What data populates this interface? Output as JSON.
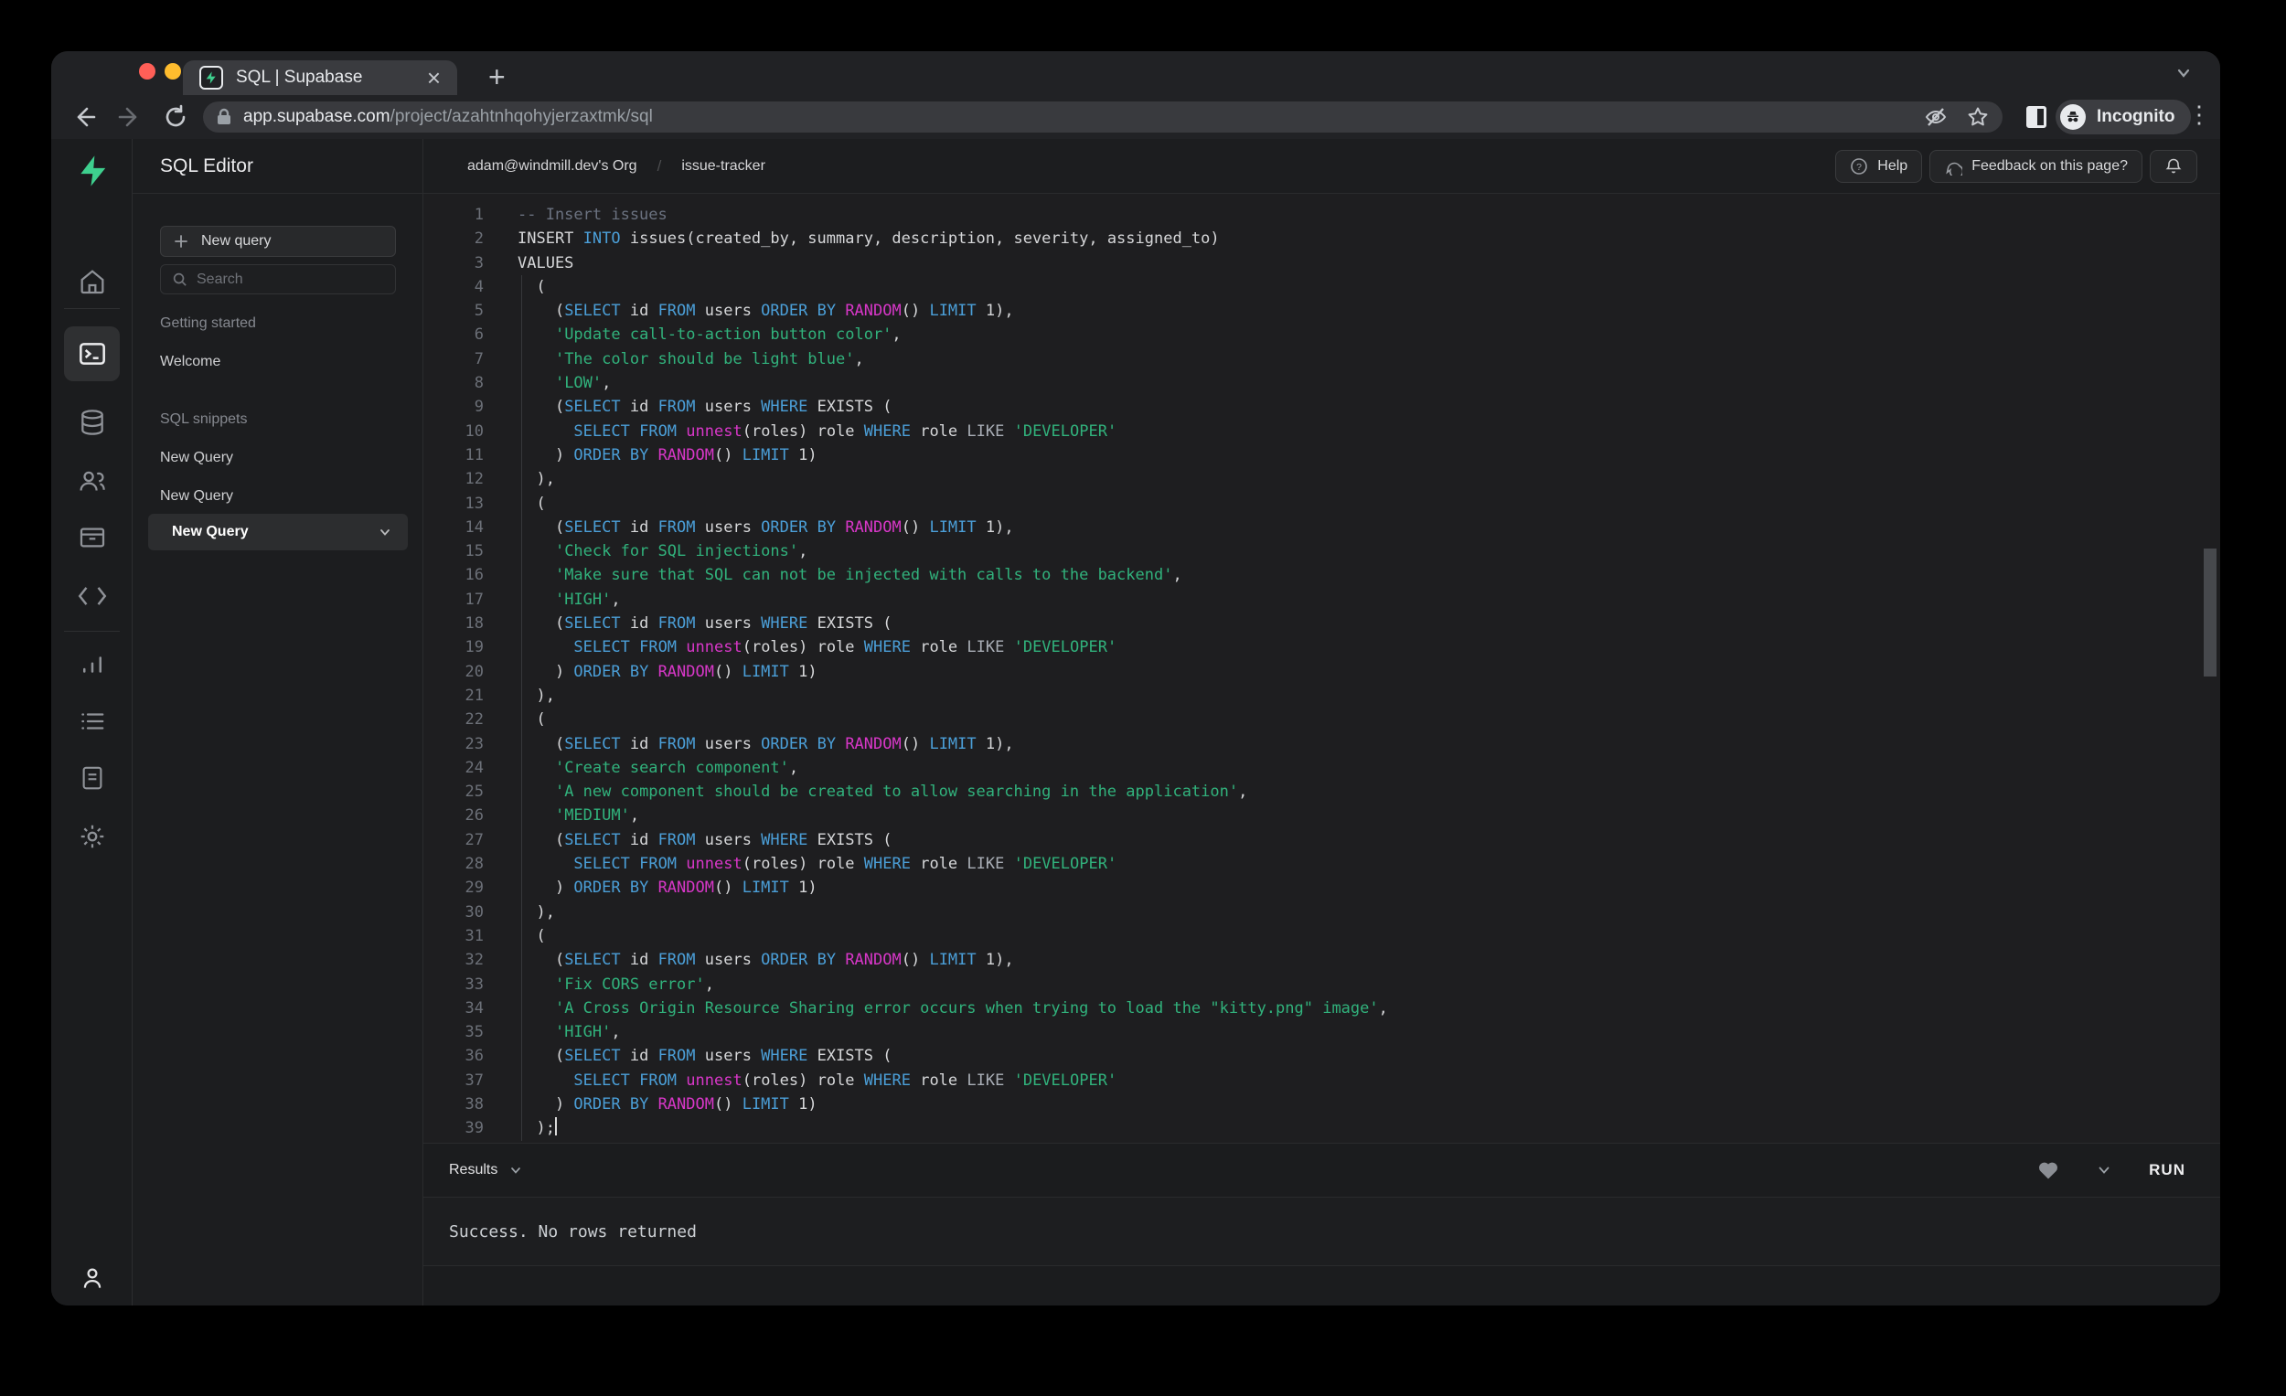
{
  "window": {
    "tab_title": "SQL | Supabase",
    "close_glyph": "×",
    "newtab_glyph": "+",
    "kebab_glyph": "⋮",
    "url_host": "app.supabase.com",
    "url_path": "/project/azahtnhqohyjerzaxtmk/sql",
    "incognito_label": "Incognito"
  },
  "colors": {
    "accent_green": "#3ecf8e",
    "keyword_blue": "#4b9fd8",
    "function_magenta": "#d837c8",
    "string_green": "#31b27c",
    "comment_gray": "#6b7280"
  },
  "sidebar": {
    "title": "SQL Editor",
    "new_query_button": "New query",
    "search_placeholder": "Search",
    "getting_started_label": "Getting started",
    "welcome_label": "Welcome",
    "snippets_label": "SQL snippets",
    "snippet_items": [
      "New Query",
      "New Query"
    ],
    "selected_snippet": "New Query"
  },
  "topbar": {
    "org": "adam@windmill.dev's Org",
    "separator": "/",
    "project": "issue-tracker",
    "help_label": "Help",
    "help_glyph": "?",
    "feedback_label": "Feedback on this page?"
  },
  "results": {
    "label": "Results",
    "run_label": "RUN",
    "message": "Success. No rows returned"
  },
  "editor": {
    "lines": [
      {
        "n": 1,
        "t": [
          [
            "com",
            "-- Insert issues"
          ]
        ]
      },
      {
        "n": 2,
        "t": [
          [
            "pl",
            "INSERT "
          ],
          [
            "kw",
            "INTO"
          ],
          [
            "pl",
            " issues(created_by, summary, description, severity, assigned_to)"
          ]
        ]
      },
      {
        "n": 3,
        "t": [
          [
            "pl",
            "VALUES"
          ]
        ]
      },
      {
        "n": 4,
        "t": [
          [
            "pl",
            "  ("
          ]
        ]
      },
      {
        "n": 5,
        "t": [
          [
            "pl",
            "    ("
          ],
          [
            "kw",
            "SELECT"
          ],
          [
            "pl",
            " id "
          ],
          [
            "kw",
            "FROM"
          ],
          [
            "pl",
            " users "
          ],
          [
            "kw",
            "ORDER BY"
          ],
          [
            "pl",
            " "
          ],
          [
            "fn",
            "RANDOM"
          ],
          [
            "pl",
            "() "
          ],
          [
            "kw",
            "LIMIT"
          ],
          [
            "pl",
            " 1),"
          ]
        ]
      },
      {
        "n": 6,
        "t": [
          [
            "pl",
            "    "
          ],
          [
            "str",
            "'Update call-to-action button color'"
          ],
          [
            "pl",
            ","
          ]
        ]
      },
      {
        "n": 7,
        "t": [
          [
            "pl",
            "    "
          ],
          [
            "str",
            "'The color should be light blue'"
          ],
          [
            "pl",
            ","
          ]
        ]
      },
      {
        "n": 8,
        "t": [
          [
            "pl",
            "    "
          ],
          [
            "str",
            "'LOW'"
          ],
          [
            "pl",
            ","
          ]
        ]
      },
      {
        "n": 9,
        "t": [
          [
            "pl",
            "    ("
          ],
          [
            "kw",
            "SELECT"
          ],
          [
            "pl",
            " id "
          ],
          [
            "kw",
            "FROM"
          ],
          [
            "pl",
            " users "
          ],
          [
            "kw",
            "WHERE"
          ],
          [
            "pl",
            " EXISTS ("
          ]
        ]
      },
      {
        "n": 10,
        "t": [
          [
            "pl",
            "      "
          ],
          [
            "kw",
            "SELECT"
          ],
          [
            "pl",
            " "
          ],
          [
            "kw",
            "FROM"
          ],
          [
            "pl",
            " "
          ],
          [
            "fn",
            "unnest"
          ],
          [
            "pl",
            "(roles) role "
          ],
          [
            "kw",
            "WHERE"
          ],
          [
            "pl",
            " role "
          ],
          [
            "lk",
            "LIKE"
          ],
          [
            "pl",
            " "
          ],
          [
            "str",
            "'DEVELOPER'"
          ]
        ]
      },
      {
        "n": 11,
        "t": [
          [
            "pl",
            "    ) "
          ],
          [
            "kw",
            "ORDER BY"
          ],
          [
            "pl",
            " "
          ],
          [
            "fn",
            "RANDOM"
          ],
          [
            "pl",
            "() "
          ],
          [
            "kw",
            "LIMIT"
          ],
          [
            "pl",
            " 1)"
          ]
        ]
      },
      {
        "n": 12,
        "t": [
          [
            "pl",
            "  ),"
          ]
        ]
      },
      {
        "n": 13,
        "t": [
          [
            "pl",
            "  ("
          ]
        ]
      },
      {
        "n": 14,
        "t": [
          [
            "pl",
            "    ("
          ],
          [
            "kw",
            "SELECT"
          ],
          [
            "pl",
            " id "
          ],
          [
            "kw",
            "FROM"
          ],
          [
            "pl",
            " users "
          ],
          [
            "kw",
            "ORDER BY"
          ],
          [
            "pl",
            " "
          ],
          [
            "fn",
            "RANDOM"
          ],
          [
            "pl",
            "() "
          ],
          [
            "kw",
            "LIMIT"
          ],
          [
            "pl",
            " 1),"
          ]
        ]
      },
      {
        "n": 15,
        "t": [
          [
            "pl",
            "    "
          ],
          [
            "str",
            "'Check for SQL injections'"
          ],
          [
            "pl",
            ","
          ]
        ]
      },
      {
        "n": 16,
        "t": [
          [
            "pl",
            "    "
          ],
          [
            "str",
            "'Make sure that SQL can not be injected with calls to the backend'"
          ],
          [
            "pl",
            ","
          ]
        ]
      },
      {
        "n": 17,
        "t": [
          [
            "pl",
            "    "
          ],
          [
            "str",
            "'HIGH'"
          ],
          [
            "pl",
            ","
          ]
        ]
      },
      {
        "n": 18,
        "t": [
          [
            "pl",
            "    ("
          ],
          [
            "kw",
            "SELECT"
          ],
          [
            "pl",
            " id "
          ],
          [
            "kw",
            "FROM"
          ],
          [
            "pl",
            " users "
          ],
          [
            "kw",
            "WHERE"
          ],
          [
            "pl",
            " EXISTS ("
          ]
        ]
      },
      {
        "n": 19,
        "t": [
          [
            "pl",
            "      "
          ],
          [
            "kw",
            "SELECT"
          ],
          [
            "pl",
            " "
          ],
          [
            "kw",
            "FROM"
          ],
          [
            "pl",
            " "
          ],
          [
            "fn",
            "unnest"
          ],
          [
            "pl",
            "(roles) role "
          ],
          [
            "kw",
            "WHERE"
          ],
          [
            "pl",
            " role "
          ],
          [
            "lk",
            "LIKE"
          ],
          [
            "pl",
            " "
          ],
          [
            "str",
            "'DEVELOPER'"
          ]
        ]
      },
      {
        "n": 20,
        "t": [
          [
            "pl",
            "    ) "
          ],
          [
            "kw",
            "ORDER BY"
          ],
          [
            "pl",
            " "
          ],
          [
            "fn",
            "RANDOM"
          ],
          [
            "pl",
            "() "
          ],
          [
            "kw",
            "LIMIT"
          ],
          [
            "pl",
            " 1)"
          ]
        ]
      },
      {
        "n": 21,
        "t": [
          [
            "pl",
            "  ),"
          ]
        ]
      },
      {
        "n": 22,
        "t": [
          [
            "pl",
            "  ("
          ]
        ]
      },
      {
        "n": 23,
        "t": [
          [
            "pl",
            "    ("
          ],
          [
            "kw",
            "SELECT"
          ],
          [
            "pl",
            " id "
          ],
          [
            "kw",
            "FROM"
          ],
          [
            "pl",
            " users "
          ],
          [
            "kw",
            "ORDER BY"
          ],
          [
            "pl",
            " "
          ],
          [
            "fn",
            "RANDOM"
          ],
          [
            "pl",
            "() "
          ],
          [
            "kw",
            "LIMIT"
          ],
          [
            "pl",
            " 1),"
          ]
        ]
      },
      {
        "n": 24,
        "t": [
          [
            "pl",
            "    "
          ],
          [
            "str",
            "'Create search component'"
          ],
          [
            "pl",
            ","
          ]
        ]
      },
      {
        "n": 25,
        "t": [
          [
            "pl",
            "    "
          ],
          [
            "str",
            "'A new component should be created to allow searching in the application'"
          ],
          [
            "pl",
            ","
          ]
        ]
      },
      {
        "n": 26,
        "t": [
          [
            "pl",
            "    "
          ],
          [
            "str",
            "'MEDIUM'"
          ],
          [
            "pl",
            ","
          ]
        ]
      },
      {
        "n": 27,
        "t": [
          [
            "pl",
            "    ("
          ],
          [
            "kw",
            "SELECT"
          ],
          [
            "pl",
            " id "
          ],
          [
            "kw",
            "FROM"
          ],
          [
            "pl",
            " users "
          ],
          [
            "kw",
            "WHERE"
          ],
          [
            "pl",
            " EXISTS ("
          ]
        ]
      },
      {
        "n": 28,
        "t": [
          [
            "pl",
            "      "
          ],
          [
            "kw",
            "SELECT"
          ],
          [
            "pl",
            " "
          ],
          [
            "kw",
            "FROM"
          ],
          [
            "pl",
            " "
          ],
          [
            "fn",
            "unnest"
          ],
          [
            "pl",
            "(roles) role "
          ],
          [
            "kw",
            "WHERE"
          ],
          [
            "pl",
            " role "
          ],
          [
            "lk",
            "LIKE"
          ],
          [
            "pl",
            " "
          ],
          [
            "str",
            "'DEVELOPER'"
          ]
        ]
      },
      {
        "n": 29,
        "t": [
          [
            "pl",
            "    ) "
          ],
          [
            "kw",
            "ORDER BY"
          ],
          [
            "pl",
            " "
          ],
          [
            "fn",
            "RANDOM"
          ],
          [
            "pl",
            "() "
          ],
          [
            "kw",
            "LIMIT"
          ],
          [
            "pl",
            " 1)"
          ]
        ]
      },
      {
        "n": 30,
        "t": [
          [
            "pl",
            "  ),"
          ]
        ]
      },
      {
        "n": 31,
        "t": [
          [
            "pl",
            "  ("
          ]
        ]
      },
      {
        "n": 32,
        "t": [
          [
            "pl",
            "    ("
          ],
          [
            "kw",
            "SELECT"
          ],
          [
            "pl",
            " id "
          ],
          [
            "kw",
            "FROM"
          ],
          [
            "pl",
            " users "
          ],
          [
            "kw",
            "ORDER BY"
          ],
          [
            "pl",
            " "
          ],
          [
            "fn",
            "RANDOM"
          ],
          [
            "pl",
            "() "
          ],
          [
            "kw",
            "LIMIT"
          ],
          [
            "pl",
            " 1),"
          ]
        ]
      },
      {
        "n": 33,
        "t": [
          [
            "pl",
            "    "
          ],
          [
            "str",
            "'Fix CORS error'"
          ],
          [
            "pl",
            ","
          ]
        ]
      },
      {
        "n": 34,
        "t": [
          [
            "pl",
            "    "
          ],
          [
            "str",
            "'A Cross Origin Resource Sharing error occurs when trying to load the \"kitty.png\" image'"
          ],
          [
            "pl",
            ","
          ]
        ]
      },
      {
        "n": 35,
        "t": [
          [
            "pl",
            "    "
          ],
          [
            "str",
            "'HIGH'"
          ],
          [
            "pl",
            ","
          ]
        ]
      },
      {
        "n": 36,
        "t": [
          [
            "pl",
            "    ("
          ],
          [
            "kw",
            "SELECT"
          ],
          [
            "pl",
            " id "
          ],
          [
            "kw",
            "FROM"
          ],
          [
            "pl",
            " users "
          ],
          [
            "kw",
            "WHERE"
          ],
          [
            "pl",
            " EXISTS ("
          ]
        ]
      },
      {
        "n": 37,
        "t": [
          [
            "pl",
            "      "
          ],
          [
            "kw",
            "SELECT"
          ],
          [
            "pl",
            " "
          ],
          [
            "kw",
            "FROM"
          ],
          [
            "pl",
            " "
          ],
          [
            "fn",
            "unnest"
          ],
          [
            "pl",
            "(roles) role "
          ],
          [
            "kw",
            "WHERE"
          ],
          [
            "pl",
            " role "
          ],
          [
            "lk",
            "LIKE"
          ],
          [
            "pl",
            " "
          ],
          [
            "str",
            "'DEVELOPER'"
          ]
        ]
      },
      {
        "n": 38,
        "t": [
          [
            "pl",
            "    ) "
          ],
          [
            "kw",
            "ORDER BY"
          ],
          [
            "pl",
            " "
          ],
          [
            "fn",
            "RANDOM"
          ],
          [
            "pl",
            "() "
          ],
          [
            "kw",
            "LIMIT"
          ],
          [
            "pl",
            " 1)"
          ]
        ]
      },
      {
        "n": 39,
        "t": [
          [
            "pl",
            "  );"
          ]
        ],
        "caret": true
      }
    ]
  }
}
